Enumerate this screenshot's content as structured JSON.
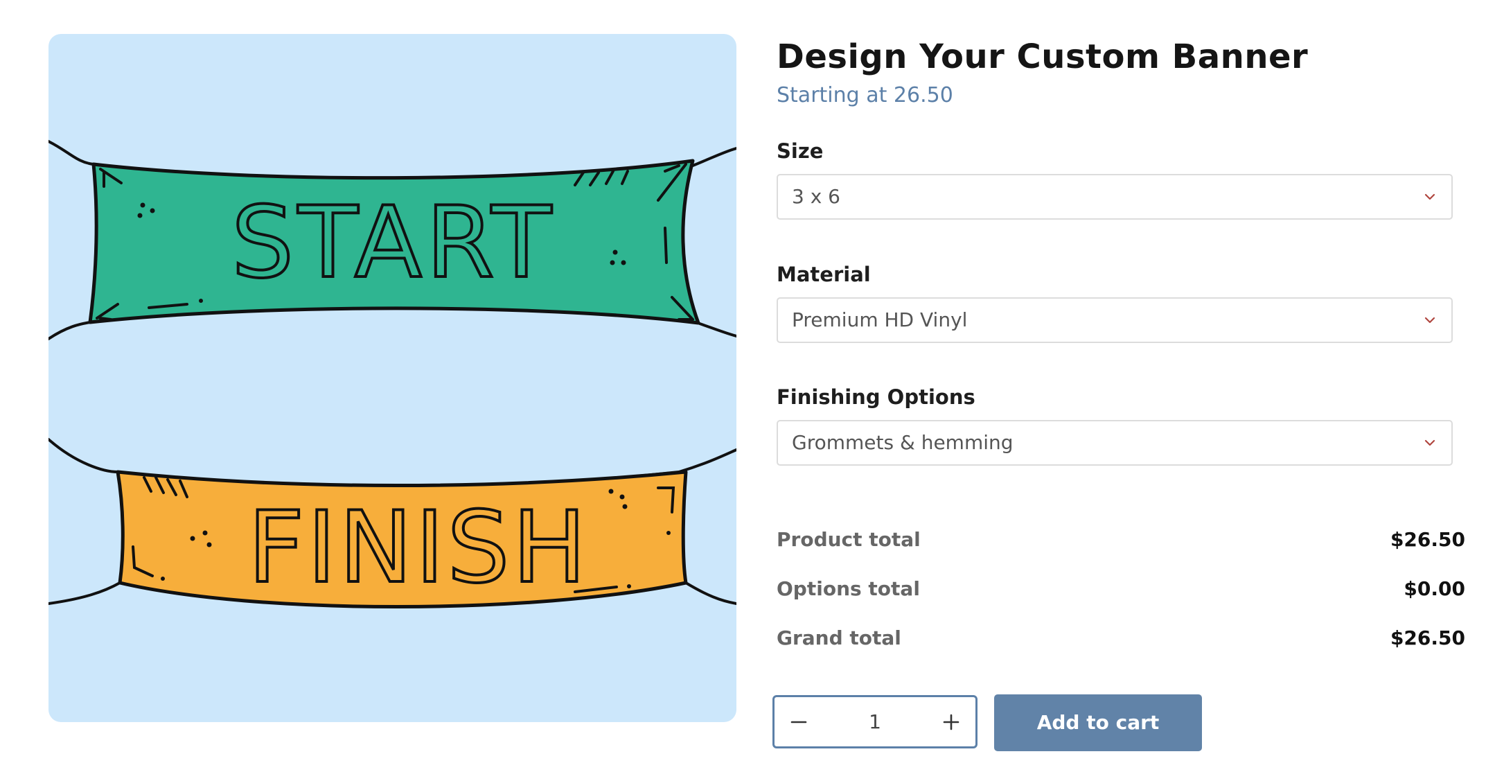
{
  "product": {
    "title": "Design Your Custom Banner",
    "starting_price": "Starting at 26.50"
  },
  "image": {
    "banner_top_text": "START",
    "banner_bottom_text": "FINISH",
    "colors": {
      "background": "#cce7fb",
      "top_banner": "#2fb591",
      "bottom_banner": "#f7ae3b"
    }
  },
  "options": [
    {
      "label": "Size",
      "value": "3 x 6",
      "icon": "chevron-down-icon"
    },
    {
      "label": "Material",
      "value": "Premium HD Vinyl",
      "icon": "chevron-down-icon"
    },
    {
      "label": "Finishing Options",
      "value": "Grommets & hemming",
      "icon": "chevron-down-icon"
    }
  ],
  "totals": {
    "product": {
      "label": "Product total",
      "value": "$26.50"
    },
    "options": {
      "label": "Options total",
      "value": "$0.00"
    },
    "grand": {
      "label": "Grand total",
      "value": "$26.50"
    }
  },
  "cart": {
    "quantity": "1",
    "decrement_icon": "minus-icon",
    "increment_icon": "plus-icon",
    "add_label": "Add to cart"
  },
  "theme": {
    "accent": "#5c80a8",
    "button": "#6183a8",
    "chevron": "#b0463f"
  }
}
